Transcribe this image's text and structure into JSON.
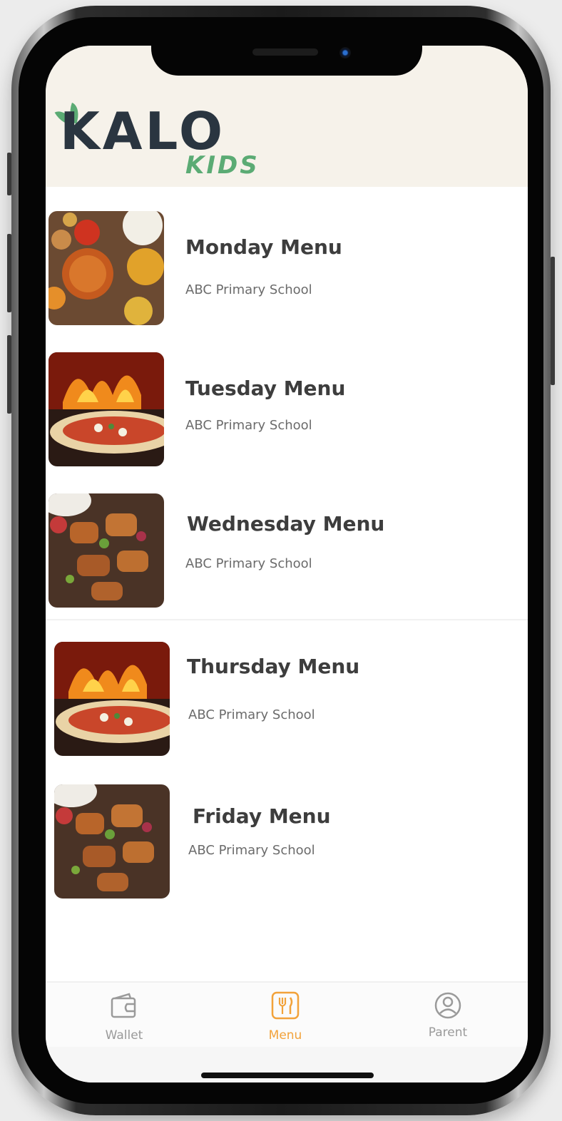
{
  "app": {
    "logo_text": "KALO",
    "logo_sub": "KIDS",
    "brand_color": "#5bab74",
    "accent_color": "#f2a23a"
  },
  "menus": [
    {
      "title": "Monday Menu",
      "school": "ABC Primary School",
      "image": "indian-curry-platter"
    },
    {
      "title": "Tuesday Menu",
      "school": "ABC Primary School",
      "image": "wood-fired-pizza"
    },
    {
      "title": "Wednesday Menu",
      "school": "ABC Primary School",
      "image": "chicken-kebabs"
    },
    {
      "title": "Thursday Menu",
      "school": "ABC Primary School",
      "image": "wood-fired-pizza"
    },
    {
      "title": "Friday Menu",
      "school": "ABC Primary School",
      "image": "chicken-kebabs"
    }
  ],
  "tabs": [
    {
      "label": "Wallet",
      "icon": "wallet-icon",
      "active": false
    },
    {
      "label": "Menu",
      "icon": "menu-utensils-icon",
      "active": true
    },
    {
      "label": "Parent",
      "icon": "user-circle-icon",
      "active": false
    }
  ]
}
